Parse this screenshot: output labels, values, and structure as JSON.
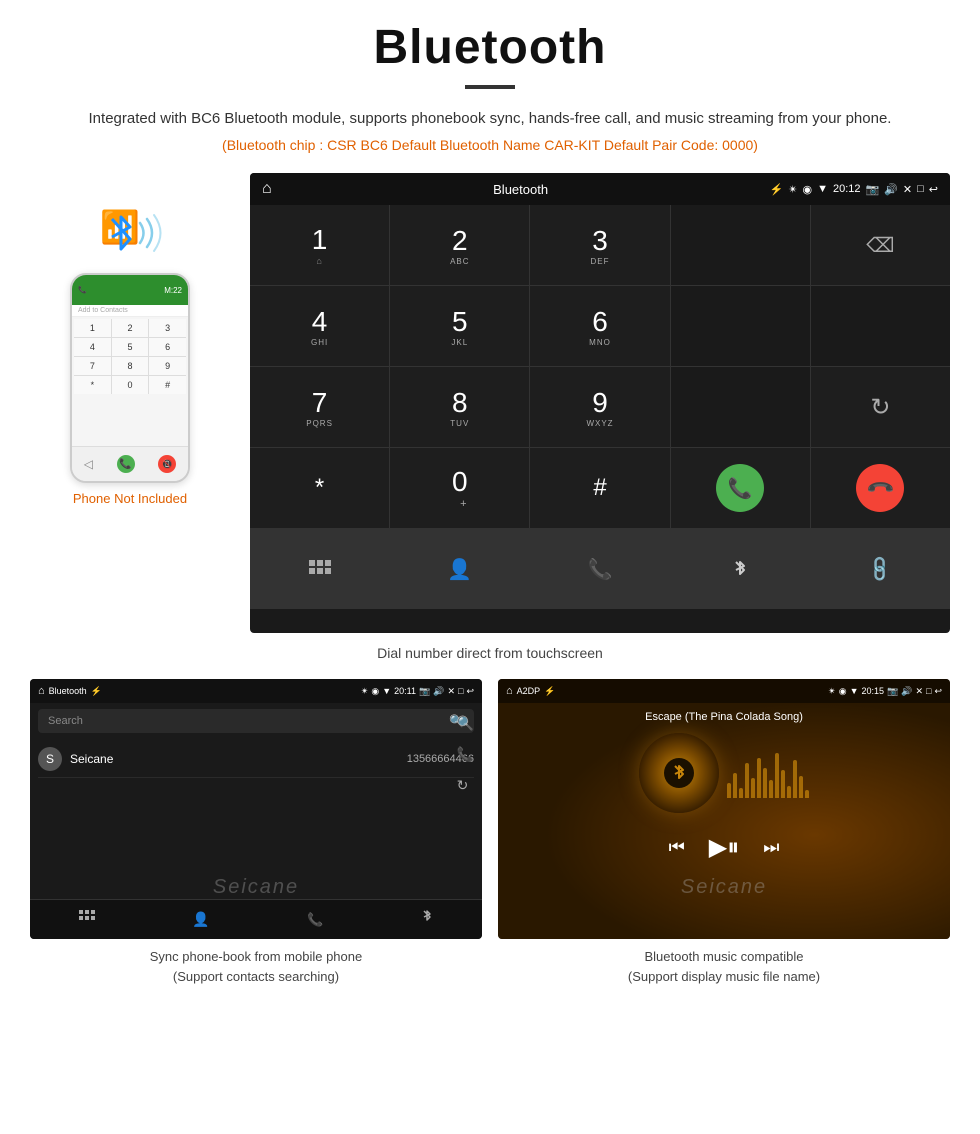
{
  "header": {
    "title": "Bluetooth",
    "description": "Integrated with BC6 Bluetooth module, supports phonebook sync, hands-free call, and music streaming from your phone.",
    "specs": "(Bluetooth chip : CSR BC6    Default Bluetooth Name CAR-KIT    Default Pair Code: 0000)"
  },
  "phone_side": {
    "not_included_label": "Phone Not Included",
    "screen_label": "Add to Contacts"
  },
  "large_dial": {
    "statusbar": {
      "app_title": "Bluetooth",
      "time": "20:12"
    },
    "keys": [
      {
        "num": "1",
        "sub": ""
      },
      {
        "num": "2",
        "sub": "ABC"
      },
      {
        "num": "3",
        "sub": "DEF"
      },
      {
        "num": "4",
        "sub": "GHI"
      },
      {
        "num": "5",
        "sub": "JKL"
      },
      {
        "num": "6",
        "sub": "MNO"
      },
      {
        "num": "7",
        "sub": "PQRS"
      },
      {
        "num": "8",
        "sub": "TUV"
      },
      {
        "num": "9",
        "sub": "WXYZ"
      },
      {
        "num": "*",
        "sub": ""
      },
      {
        "num": "0",
        "sub": "+"
      },
      {
        "num": "#",
        "sub": ""
      }
    ],
    "caption": "Dial number direct from touchscreen"
  },
  "phonebook_screen": {
    "statusbar": {
      "app_title": "Bluetooth",
      "time": "20:11"
    },
    "search_placeholder": "Search",
    "contacts": [
      {
        "initial": "S",
        "name": "Seicane",
        "phone": "13566664466"
      }
    ],
    "caption_line1": "Sync phone-book from mobile phone",
    "caption_line2": "(Support contacts searching)"
  },
  "music_screen": {
    "statusbar": {
      "app_title": "A2DP",
      "time": "20:15"
    },
    "song_title": "Escape (The Pina Colada Song)",
    "caption_line1": "Bluetooth music compatible",
    "caption_line2": "(Support display music file name)"
  },
  "watermark": "Seicane"
}
